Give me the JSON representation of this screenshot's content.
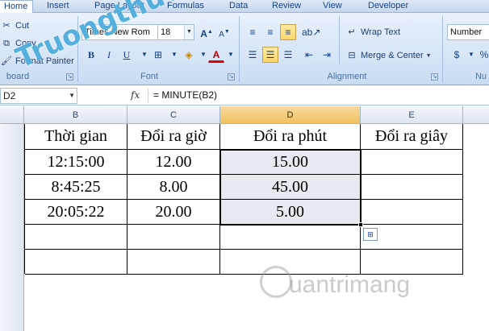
{
  "tabs": [
    "Home",
    "Insert",
    "Page Layout",
    "Formulas",
    "Data",
    "Review",
    "View",
    "Developer"
  ],
  "clipboard": {
    "cut": "Cut",
    "copy": "Copy",
    "format_painter": "Format Painter",
    "label": "board"
  },
  "font": {
    "name": "Times New Rom",
    "size": "18",
    "label": "Font",
    "bold": "B",
    "italic": "I",
    "underline": "U",
    "grow": "A",
    "shrink": "A",
    "font_color": "A"
  },
  "alignment": {
    "wrap": "Wrap Text",
    "merge": "Merge & Center",
    "label": "Alignment"
  },
  "number": {
    "format": "Number",
    "label": "Nu",
    "currency": "$",
    "percent": "%"
  },
  "formula_bar": {
    "name_box": "D2",
    "fx": "fx",
    "formula": "= MINUTE(B2)"
  },
  "columns": [
    "B",
    "C",
    "D",
    "E"
  ],
  "table": {
    "headers": [
      "Thời gian",
      "Đổi ra giờ",
      "Đổi ra phút",
      "Đổi ra giây"
    ],
    "rows": [
      [
        "12:15:00",
        "12.00",
        "15.00",
        ""
      ],
      [
        "8:45:25",
        "8.00",
        "45.00",
        ""
      ],
      [
        "20:05:22",
        "20.00",
        "5.00",
        ""
      ],
      [
        "",
        "",
        "",
        ""
      ],
      [
        "",
        "",
        "",
        ""
      ]
    ]
  },
  "watermarks": {
    "top": "Truongthuvn",
    "bottom": "uantrimang"
  },
  "colors": {
    "accent": "#15428b",
    "selected_col": "#f1c15f",
    "selection_fill": "#e8eaf2"
  }
}
